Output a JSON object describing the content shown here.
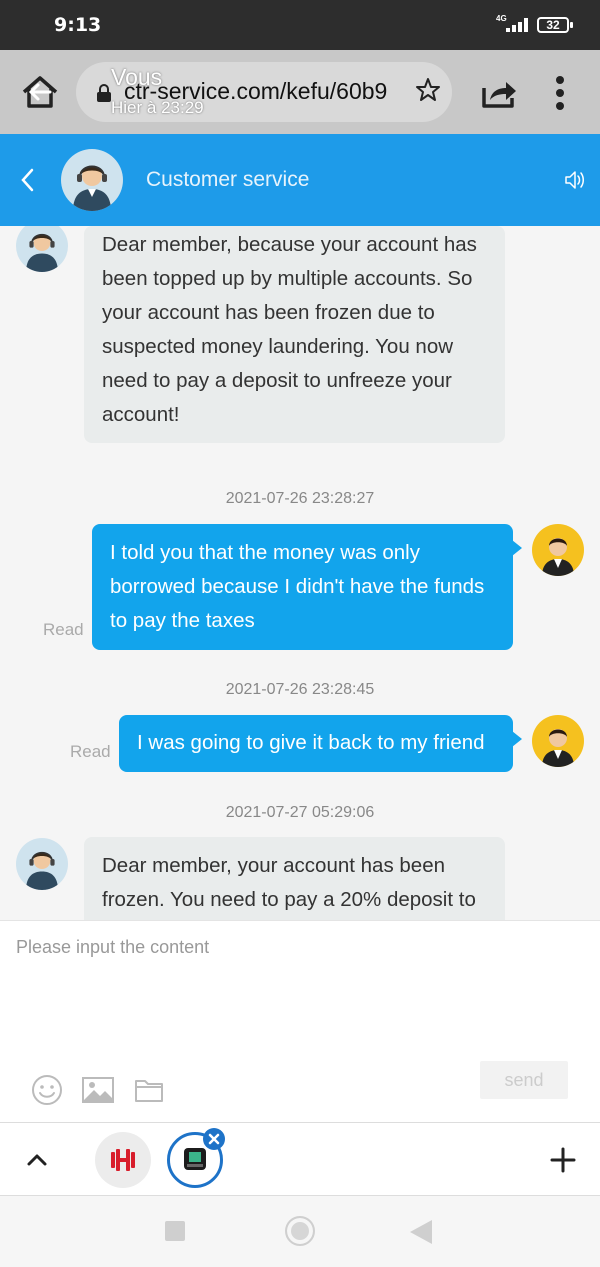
{
  "status_bar": {
    "time": "9:13",
    "network": "4G",
    "battery": "32"
  },
  "browser": {
    "url": "ctr-service.com/kefu/60b9",
    "notification_title": "Vous",
    "notification_subtitle": "Hier à 23:29"
  },
  "header": {
    "title": "Customer service"
  },
  "chat": {
    "messages": [
      {
        "type": "received",
        "lines": [
          "Dear member, because your account has",
          "been topped up by multiple accounts. So",
          "your account has been frozen due to",
          "suspected money laundering. You now",
          "need to pay a deposit to unfreeze your",
          "account!"
        ]
      },
      {
        "type": "sent",
        "timestamp": "2021-07-26 23:28:27",
        "status": "Read",
        "lines": [
          "I told you that the money was only",
          "borrowed because I didn't have the funds",
          "to pay the taxes"
        ]
      },
      {
        "type": "sent",
        "timestamp": "2021-07-26 23:28:45",
        "status": "Read",
        "lines": [
          "I was going to give it back to my friend"
        ]
      },
      {
        "type": "received",
        "timestamp": "2021-07-27 05:29:06",
        "lines": [
          "Dear member, your account has been",
          "frozen. You need to pay a 20% deposit to"
        ]
      }
    ]
  },
  "composer": {
    "placeholder": "Please input the content",
    "send_label": "send",
    "tools": [
      "emoji-icon",
      "image-icon",
      "folder-icon"
    ]
  },
  "tabs": {
    "icons": [
      "caret-up-icon",
      "dumbbell-app-icon",
      "app-tab-icon",
      "close-icon",
      "plus-icon"
    ]
  },
  "colors": {
    "header_blue": "#1e9be9",
    "sent_bubble": "#12a4ec",
    "received_bubble": "#e9ecec"
  }
}
